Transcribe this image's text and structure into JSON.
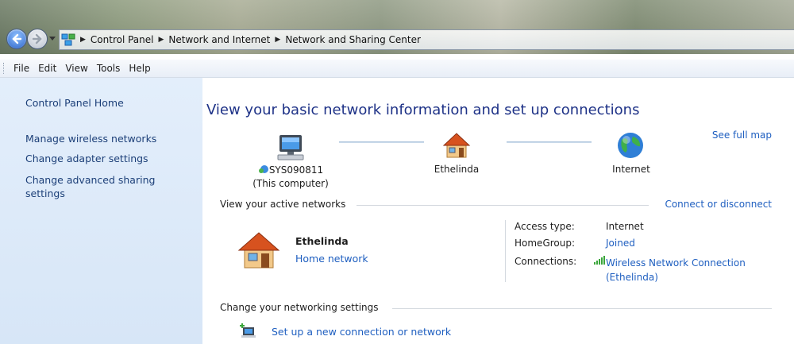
{
  "address_bar": {
    "breadcrumbs": [
      "Control Panel",
      "Network and Internet",
      "Network and Sharing Center"
    ]
  },
  "menu": [
    "File",
    "Edit",
    "View",
    "Tools",
    "Help"
  ],
  "sidebar": {
    "items": [
      {
        "label": "Control Panel Home"
      },
      {
        "label": "Manage wireless networks"
      },
      {
        "label": "Change adapter settings"
      },
      {
        "label": "Change advanced sharing settings"
      }
    ]
  },
  "main": {
    "title": "View your basic network information and set up connections",
    "see_full_map": "See full map",
    "network_map": {
      "computer_name": "SYS090811",
      "computer_sub": "(This computer)",
      "network_name": "Ethelinda",
      "internet_label": "Internet"
    },
    "active_networks": {
      "header": "View your active networks",
      "connect_link": "Connect or disconnect",
      "network_name": "Ethelinda",
      "network_type": "Home network",
      "access_type_label": "Access type:",
      "access_type_value": "Internet",
      "homegroup_label": "HomeGroup:",
      "homegroup_value": "Joined",
      "connections_label": "Connections:",
      "connection_line1": "Wireless Network Connection",
      "connection_line2": "(Ethelinda)"
    },
    "change_settings": {
      "header": "Change your networking settings",
      "setup_link": "Set up a new connection or network"
    }
  },
  "icons": [
    "back-arrow-icon",
    "forward-arrow-icon",
    "network-folder-icon",
    "computer-icon",
    "house-icon",
    "globe-icon",
    "signal-bars-icon",
    "new-connection-icon"
  ],
  "colors": {
    "link": "#1f5fc0",
    "title": "#1e3287",
    "left_pane": "#dde9f8"
  }
}
